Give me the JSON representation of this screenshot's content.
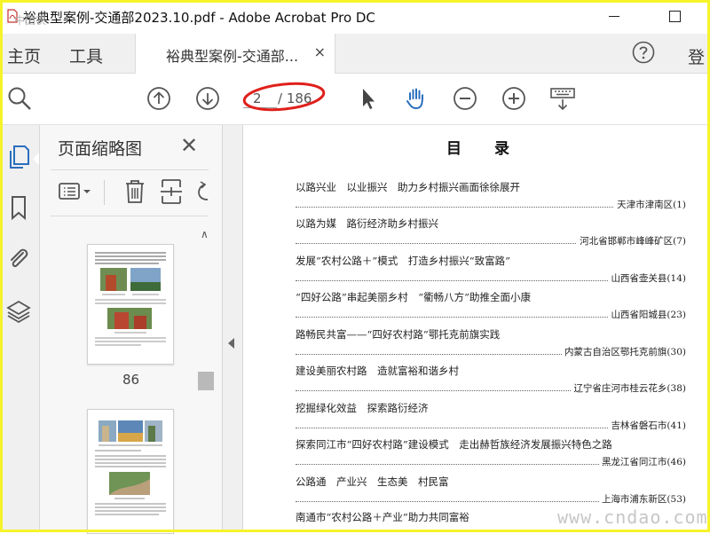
{
  "window": {
    "title": "裕典型案例-交通部2023.10.pdf - Adobe Acrobat Pro DC",
    "corner_watermark": "中国农"
  },
  "tabs": {
    "home": "主页",
    "tools": "工具",
    "document": "裕典型案例-交通部...",
    "close": "×",
    "sign_in": "登"
  },
  "toolbar": {
    "current_page": "2",
    "total_pages": "/ 186",
    "icons": [
      "search-zoom-icon",
      "page-up-icon",
      "page-down-icon",
      "select-arrow-icon",
      "hand-icon",
      "zoom-out-icon",
      "zoom-in-icon",
      "keyboard-scroll-icon"
    ]
  },
  "rail": {
    "icons": [
      "page-thumbnails-icon",
      "bookmark-icon",
      "attachment-icon",
      "layers-icon"
    ]
  },
  "panel": {
    "title": "页面缩略图",
    "close": "✕",
    "thumb_page_label": "86"
  },
  "document": {
    "toc_title": "目　　录",
    "entries": [
      {
        "title": "以路兴业　以业振兴　助力乡村振兴画面徐徐展开",
        "location": "天津市津南区(1)"
      },
      {
        "title": "以路为媒　路衍经济助乡村振兴",
        "location": "河北省邯郸市峰峰矿区(7)"
      },
      {
        "title": "发展“农村公路＋”模式　打造乡村振兴“致富路”",
        "location": "山西省壶关县(14)"
      },
      {
        "title": "“四好公路”串起美丽乡村　“衢畅八方”助推全面小康",
        "location": "山西省阳城县(23)"
      },
      {
        "title": "路畅民共富——“四好农村路”鄂托克前旗实践",
        "location": "内蒙古自治区鄂托克前旗(30)"
      },
      {
        "title": "建设美丽农村路　造就富裕和谐乡村",
        "location": "辽宁省庄河市桂云花乡(38)"
      },
      {
        "title": "挖掘绿化效益　探索路衍经济",
        "location": "吉林省磐石市(41)"
      },
      {
        "title": "探索同江市“四好农村路”建设模式　走出赫哲族经济发展振兴特色之路",
        "location": "黑龙江省同江市(46)"
      },
      {
        "title": "公路通　产业兴　生态美　村民富",
        "location": "上海市浦东新区(53)"
      },
      {
        "title": "南通市“农村公路＋产业”助力共同富裕",
        "location": ""
      }
    ]
  },
  "watermark": "www.cndao.com",
  "colors": {
    "accent_blue": "#2a6ebe",
    "annotation_red": "#e0201b",
    "frame_yellow": "#f7f32a"
  }
}
